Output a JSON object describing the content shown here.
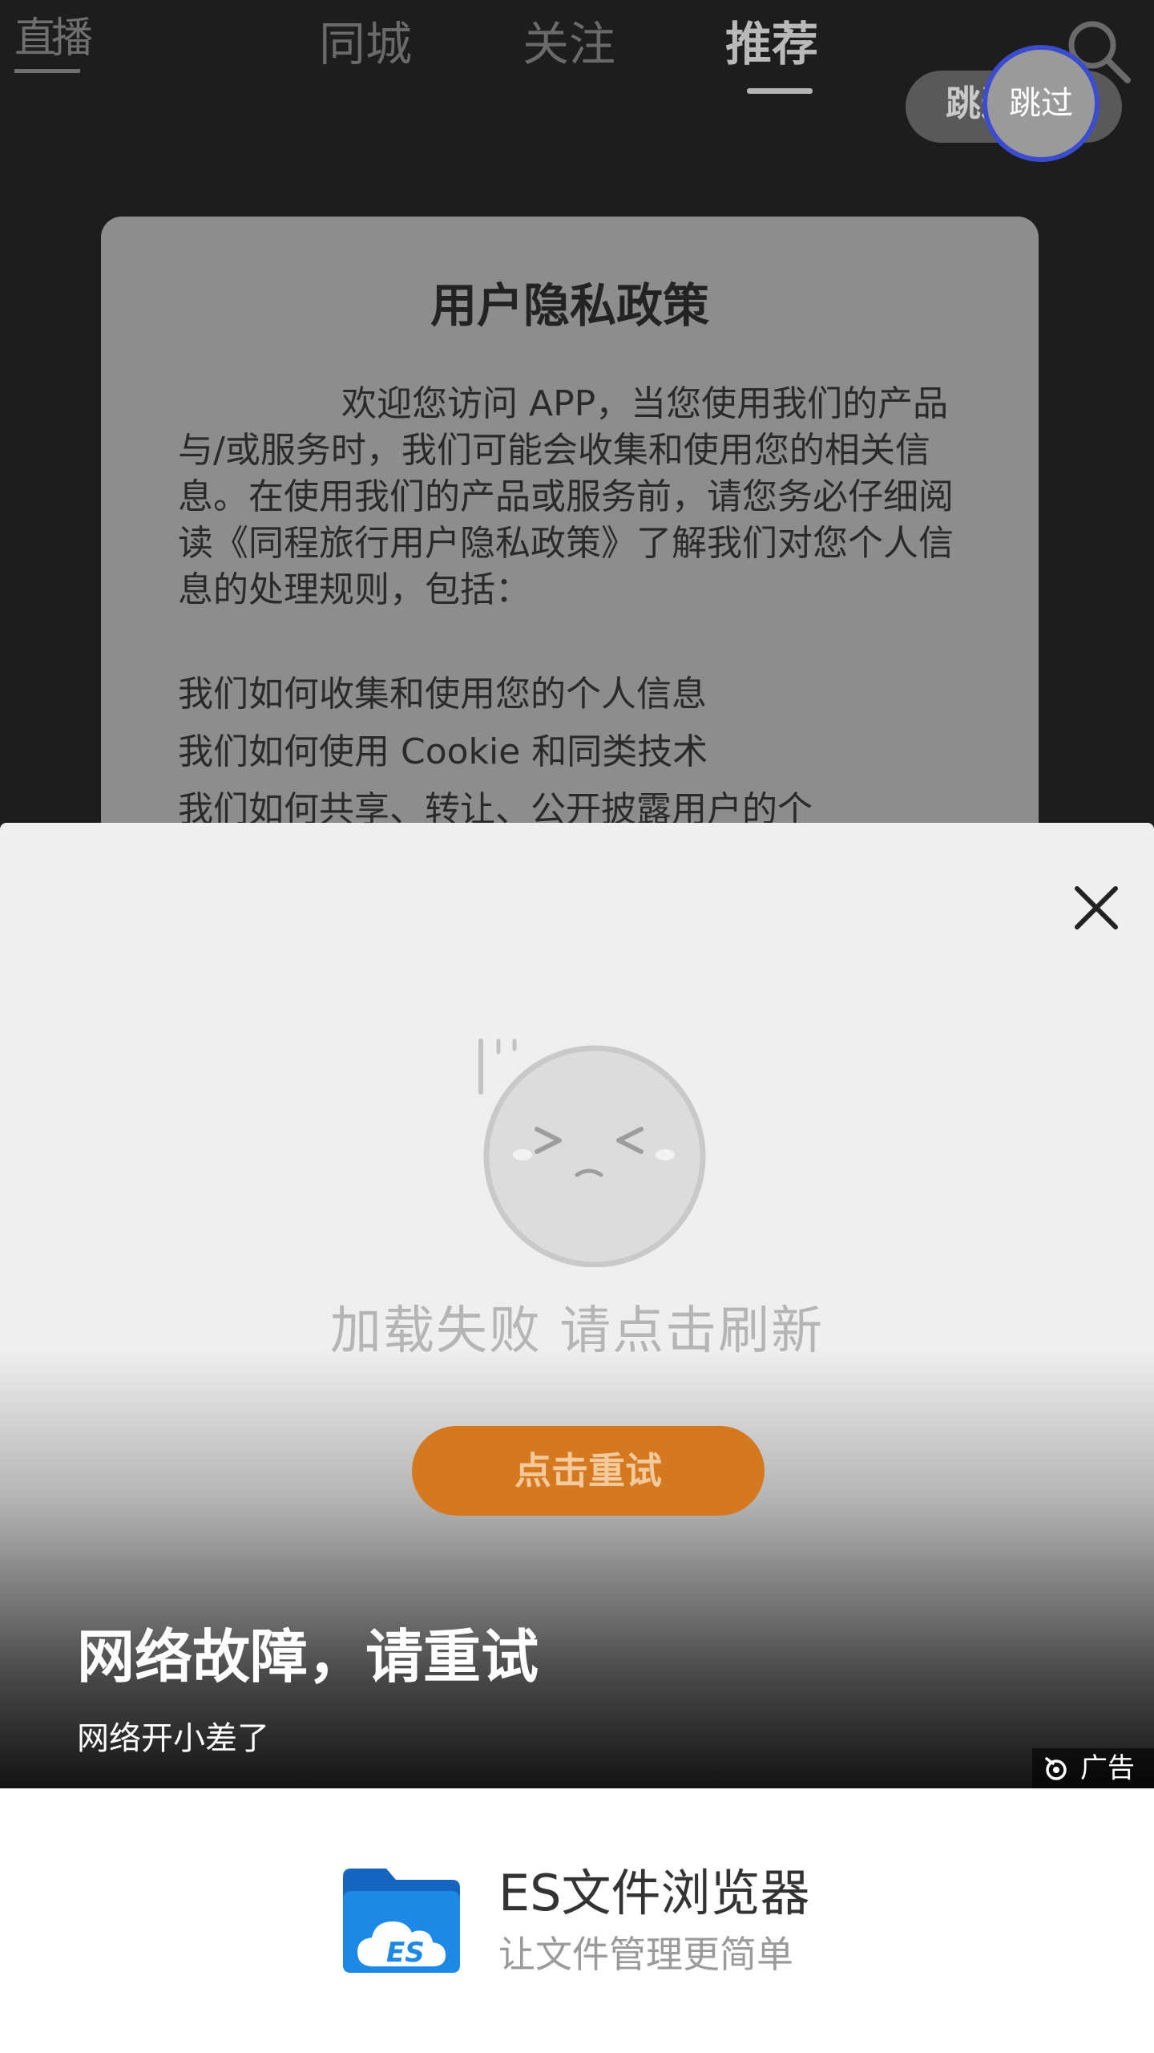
{
  "nav": {
    "live": "直播",
    "tabs": [
      "同城",
      "关注",
      "推荐"
    ],
    "skip_pill": "跳过 5"
  },
  "skip_button": {
    "label": "跳过"
  },
  "privacy": {
    "title": "用户隐私政策",
    "paragraph": "欢迎您访问 APP，当您使用我们的产品与/或服务时，我们可能会收集和使用您的相关信息。在使用我们的产品或服务前，请您务必仔细阅读《同程旅行用户隐私政策》了解我们对您个人信息的处理规则，包括：",
    "items": [
      "我们如何收集和使用您的个人信息",
      "我们如何使用 Cookie 和同类技术",
      "我们如何共享、转让、公开披露用户的个"
    ]
  },
  "panel": {
    "fail_message": "加载失败 请点击刷新",
    "retry_label": "点击重试"
  },
  "ad": {
    "title": "网络故障，请重试",
    "subtitle": "网络开小差了",
    "badge": "广告"
  },
  "app": {
    "name": "ES文件浏览器",
    "slogan": "让文件管理更简单"
  },
  "colors": {
    "accent_orange": "#d4791f",
    "skip_ring": "#3b4ccf",
    "logo_blue": "#1e88e5"
  }
}
